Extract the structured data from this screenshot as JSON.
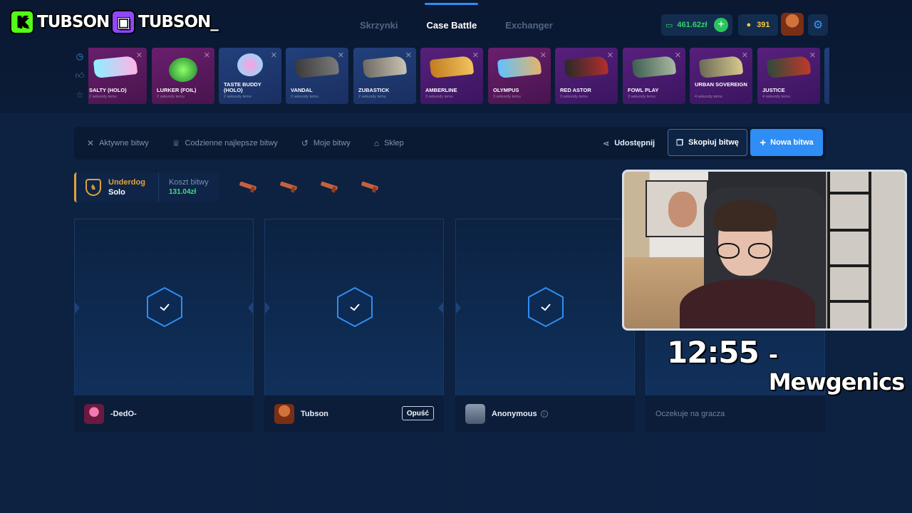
{
  "streamers": {
    "kick_name": "TUBSON",
    "kick_badge": "K",
    "twitch_name": "TUBSON_"
  },
  "nav": {
    "tabs": [
      {
        "label": "Skrzynki",
        "active": false
      },
      {
        "label": "Case Battle",
        "active": true
      },
      {
        "label": "Exchanger",
        "active": false
      }
    ]
  },
  "wallet": {
    "balance": "461.62zł",
    "coins": "391"
  },
  "colors": {
    "accent": "#2e8ef5",
    "money": "#34d26a",
    "underdog": "#e1a23a"
  },
  "live_drops": [
    {
      "name": "SALTY (HOLO)",
      "sub": "2 sekundy temu",
      "color": "pink"
    },
    {
      "name": "LURKER (FOIL)",
      "sub": "2 sekundy temu",
      "color": "pink"
    },
    {
      "name": "TASTE BUDDY (HOLO)",
      "sub": "2 sekundy temu",
      "color": "blue"
    },
    {
      "name": "VANDAL",
      "sub": "2 sekundy temu",
      "color": "blue"
    },
    {
      "name": "ZUBASTICK",
      "sub": "2 sekundy temu",
      "color": "blue"
    },
    {
      "name": "AMBERLINE",
      "sub": "3 sekundy temu",
      "color": "purple"
    },
    {
      "name": "OLYMPUS",
      "sub": "3 sekundy temu",
      "color": "pink"
    },
    {
      "name": "RED ASTOR",
      "sub": "3 sekundy temu",
      "color": "purple"
    },
    {
      "name": "FOWL PLAY",
      "sub": "3 sekundy temu",
      "color": "purple"
    },
    {
      "name": "URBAN SOVEREIGN",
      "sub": "4 sekundy temu",
      "color": "purple"
    },
    {
      "name": "JUSTICE",
      "sub": "4 sekundy temu",
      "color": "purple"
    }
  ],
  "toolbar": {
    "active": "Aktywne bitwy",
    "daily": "Codzienne najlepsze bitwy",
    "mine": "Moje bitwy",
    "shop": "Sklep",
    "share": "Udostępnij",
    "copy": "Skopiuj bitwę",
    "new": "Nowa bitwa"
  },
  "battle": {
    "mode": "Underdog",
    "type": "Solo",
    "cost_label": "Koszt bitwy",
    "cost": "131.04zł"
  },
  "players": [
    {
      "name": "-DedO-",
      "avatar": "pink"
    },
    {
      "name": "Tubson",
      "avatar": "orange",
      "leave": "Opuść"
    },
    {
      "name": "Anonymous",
      "avatar": "gray"
    }
  ],
  "waiting": "Oczekuje na gracza",
  "overlay": {
    "timer": "12:55",
    "game": "- Mewgenics"
  }
}
